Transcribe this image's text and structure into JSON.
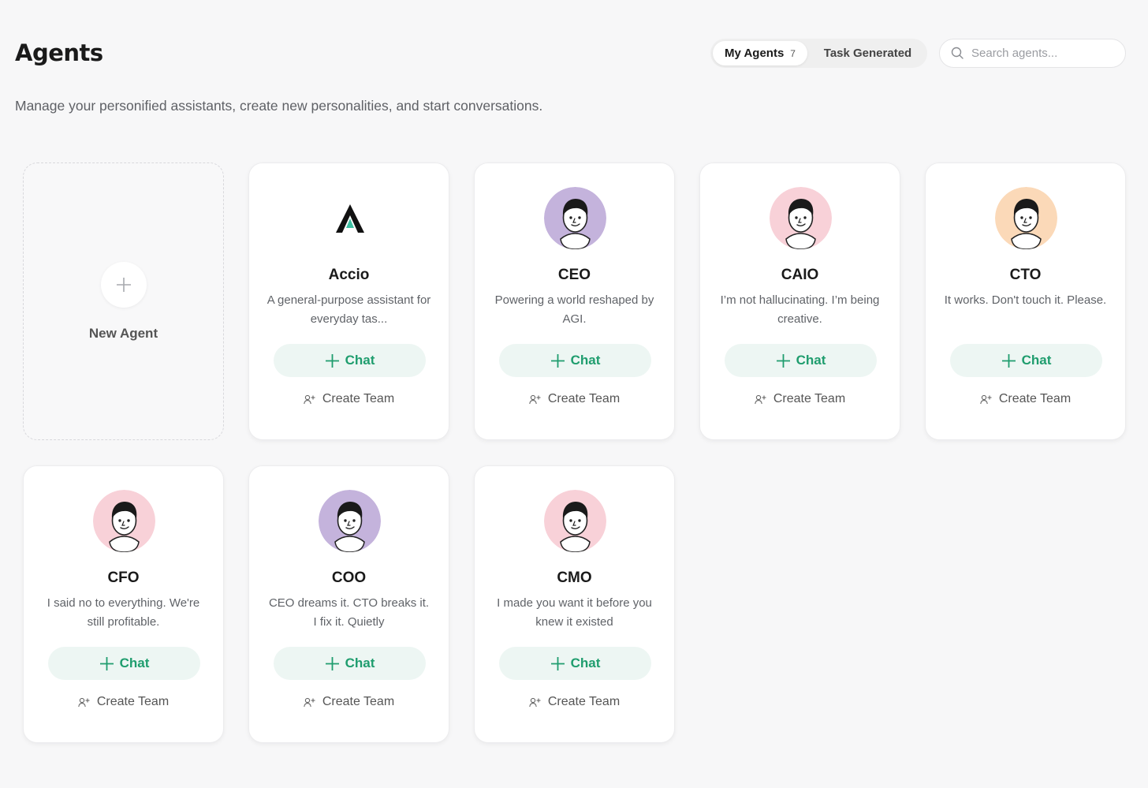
{
  "header": {
    "title": "Agents",
    "subtitle": "Manage your personified assistants, create new personalities, and start conversations."
  },
  "tabs": {
    "my_agents_label": "My Agents",
    "my_agents_count": "7",
    "task_generated_label": "Task Generated"
  },
  "search": {
    "placeholder": "Search agents..."
  },
  "new_agent": {
    "label": "New Agent"
  },
  "actions": {
    "chat_label": "Chat",
    "team_label": "Create Team"
  },
  "colors": {
    "accent_green": "#1f9d6e",
    "chat_bg": "#edf6f3",
    "avatar_purple": "#c4b3dc",
    "avatar_pink": "#f8d1d8",
    "avatar_peach": "#fbd9b8"
  },
  "agents": [
    {
      "name": "Accio",
      "description": "A general-purpose assistant for everyday tas...",
      "avatar_icon": "accio-logo-icon"
    },
    {
      "name": "CEO",
      "description": "Powering a world reshaped by AGI.",
      "avatar_icon": "face-avatar-icon",
      "avatar_color": "#c4b3dc"
    },
    {
      "name": "CAIO",
      "description": "I’m not hallucinating. I’m being creative.",
      "avatar_icon": "face-avatar-icon",
      "avatar_color": "#f8d1d8"
    },
    {
      "name": "CTO",
      "description": "It works. Don't touch it. Please.",
      "avatar_icon": "face-avatar-icon",
      "avatar_color": "#fbd9b8"
    },
    {
      "name": "CFO",
      "description": "I said no to everything. We're still profitable.",
      "avatar_icon": "face-avatar-icon",
      "avatar_color": "#f8d1d8"
    },
    {
      "name": "COO",
      "description": "CEO dreams it. CTO breaks it. I fix it. Quietly",
      "avatar_icon": "face-avatar-icon",
      "avatar_color": "#c4b3dc"
    },
    {
      "name": "CMO",
      "description": "I made you want it before you knew it existed",
      "avatar_icon": "face-avatar-icon",
      "avatar_color": "#f8d1d8"
    }
  ]
}
